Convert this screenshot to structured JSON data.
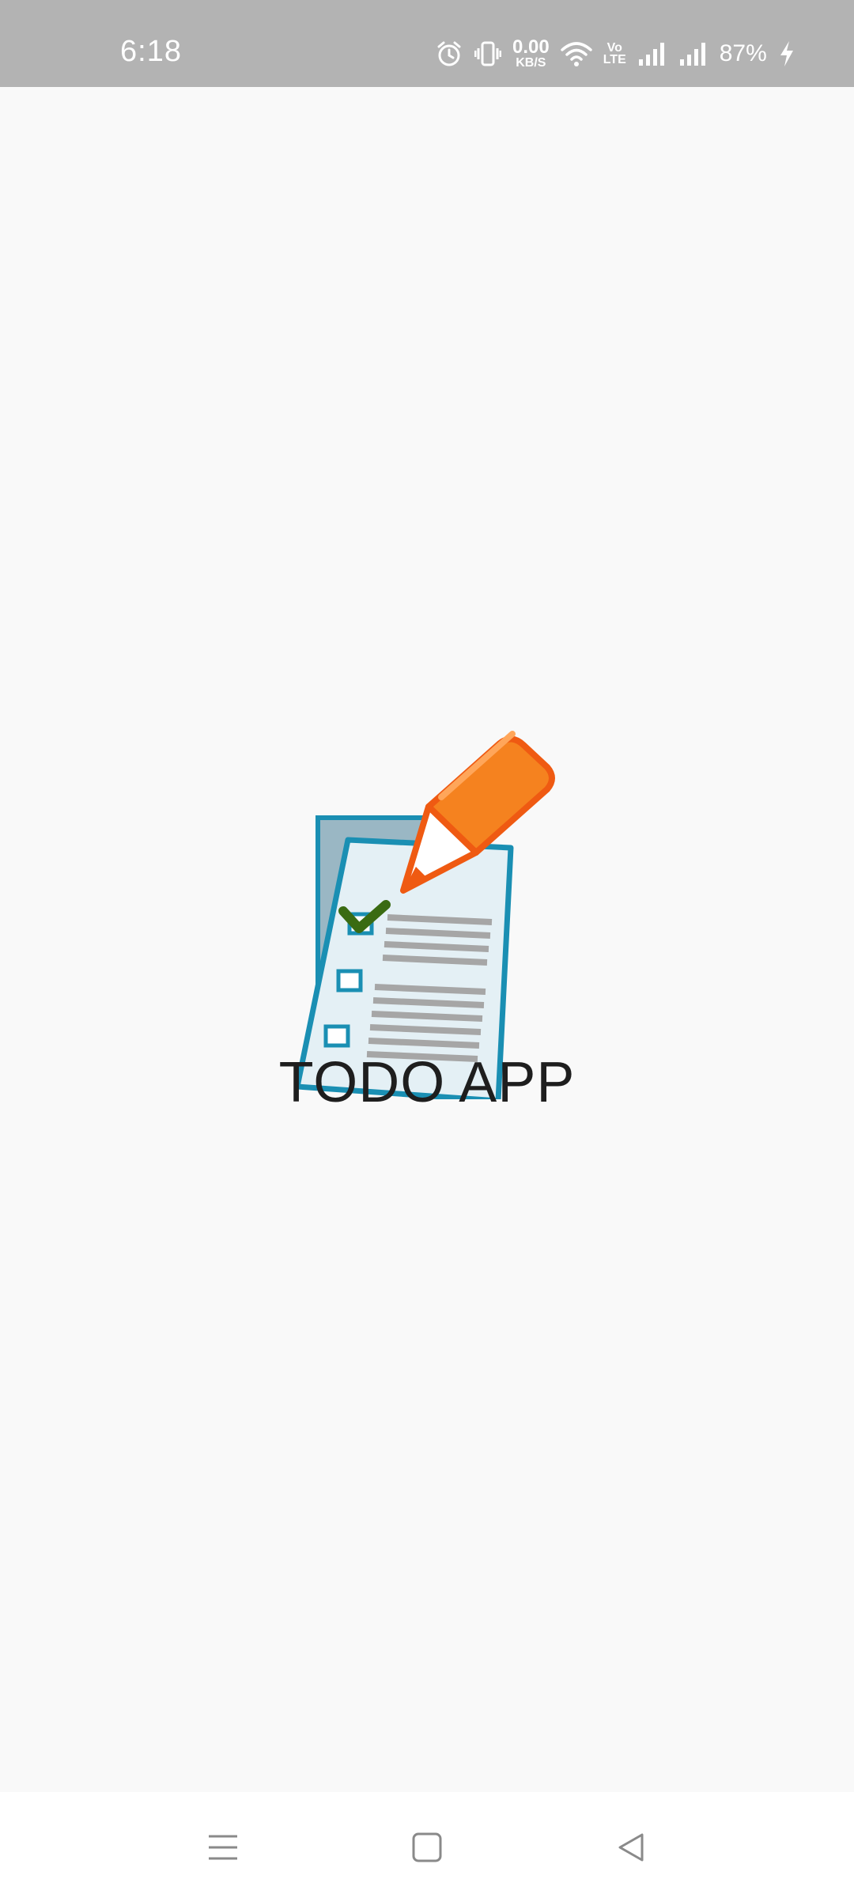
{
  "status_bar": {
    "time": "6:18",
    "net_speed_value": "0.00",
    "net_speed_unit": "KB/S",
    "volte_top": "Vo",
    "volte_bottom": "LTE",
    "battery_percent": "87%",
    "icons": [
      "alarm-icon",
      "vibrate-icon",
      "wifi-icon",
      "volte-icon",
      "signal-icon",
      "signal-icon",
      "charging-icon"
    ]
  },
  "splash": {
    "title": "TODO APP",
    "logo": "todo-checklist-pencil-logo"
  },
  "nav_bar": {
    "buttons": [
      "menu-icon",
      "home-icon",
      "back-icon"
    ]
  },
  "colors": {
    "status_bar_bg": "#b3b3b3",
    "page_bg": "#f9f9f9",
    "title_text": "#1e1e1e",
    "logo_blue": "#1a8fb3",
    "logo_orange": "#f26a1b"
  }
}
